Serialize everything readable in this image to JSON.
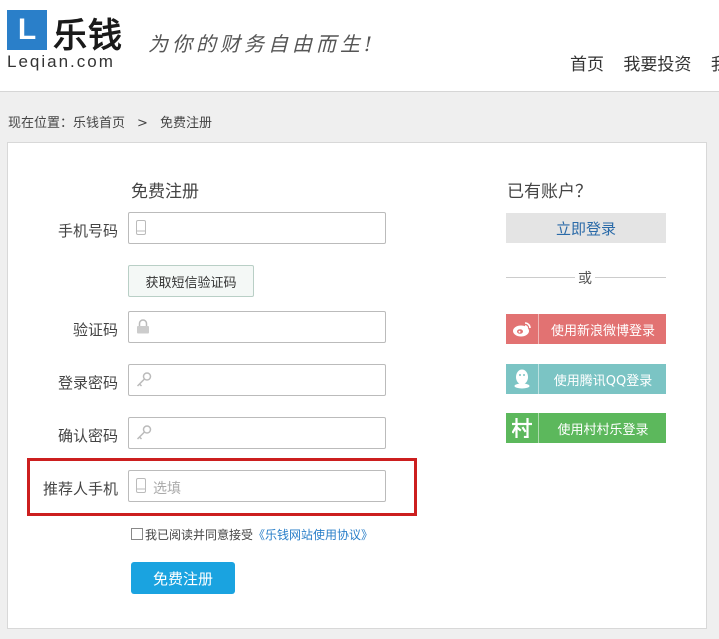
{
  "header": {
    "logo_letter": "L",
    "logo_name": "乐钱",
    "logo_domain": "Leqian.com",
    "slogan": "为你的财务自由而生!",
    "nav": [
      "首页",
      "我要投资",
      "我"
    ]
  },
  "breadcrumb": {
    "prefix": "现在位置：",
    "home": "乐钱首页",
    "separator": ">",
    "current": "免费注册"
  },
  "form": {
    "title": "免费注册",
    "phone_label": "手机号码",
    "sms_button": "获取短信验证码",
    "code_label": "验证码",
    "password_label": "登录密码",
    "confirm_label": "确认密码",
    "referrer_label": "推荐人手机",
    "referrer_placeholder": "选填",
    "agree_text": "我已阅读并同意接受",
    "agree_link": "《乐钱网站使用协议》",
    "submit": "免费注册"
  },
  "login_side": {
    "title": "已有账户？",
    "login_button": "立即登录",
    "or": "或",
    "social": [
      {
        "label": "使用新浪微博登录",
        "icon": "weibo-icon",
        "color": "#e27272"
      },
      {
        "label": "使用腾讯QQ登录",
        "icon": "qq-icon",
        "color": "#7bc4c4"
      },
      {
        "label": "使用村村乐登录",
        "icon": "cunyue-icon",
        "color": "#5cb85c"
      }
    ]
  },
  "colors": {
    "brand": "#2a7fc9",
    "highlight_border": "#cc1f1f",
    "submit_bg": "#1aa3e0"
  }
}
